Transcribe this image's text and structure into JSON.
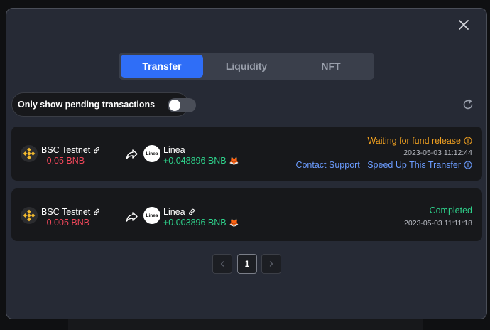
{
  "tabs": [
    {
      "label": "Transfer",
      "active": true
    },
    {
      "label": "Liquidity",
      "active": false
    },
    {
      "label": "NFT",
      "active": false
    }
  ],
  "filter": {
    "label": "Only show pending transactions",
    "toggle_on": false
  },
  "transactions": [
    {
      "from_chain": "BSC Testnet",
      "from_amount": "- 0.05 BNB",
      "to_chain": "Linea",
      "to_logo_text": "Linea",
      "to_amount": "+0.048896 BNB",
      "status": "Waiting for fund release",
      "status_color": "#f0a020",
      "timestamp": "2023-05-03 11:12:44",
      "contact_support": "Contact Support",
      "speed_up": "Speed Up This Transfer"
    },
    {
      "from_chain": "BSC Testnet",
      "from_amount": "- 0.005 BNB",
      "to_chain": "Linea",
      "to_logo_text": "Linea",
      "to_amount": "+0.003896 BNB",
      "status": "Completed",
      "status_color": "#2ed18b",
      "timestamp": "2023-05-03 11:11:18"
    }
  ],
  "pagination": {
    "current_page": "1"
  },
  "colors": {
    "accent": "#2f6ef7",
    "negative": "#f0475a",
    "positive": "#2ed18b",
    "pending": "#f0a020",
    "link": "#6b9cff",
    "bnb": "#f3ba2f"
  }
}
